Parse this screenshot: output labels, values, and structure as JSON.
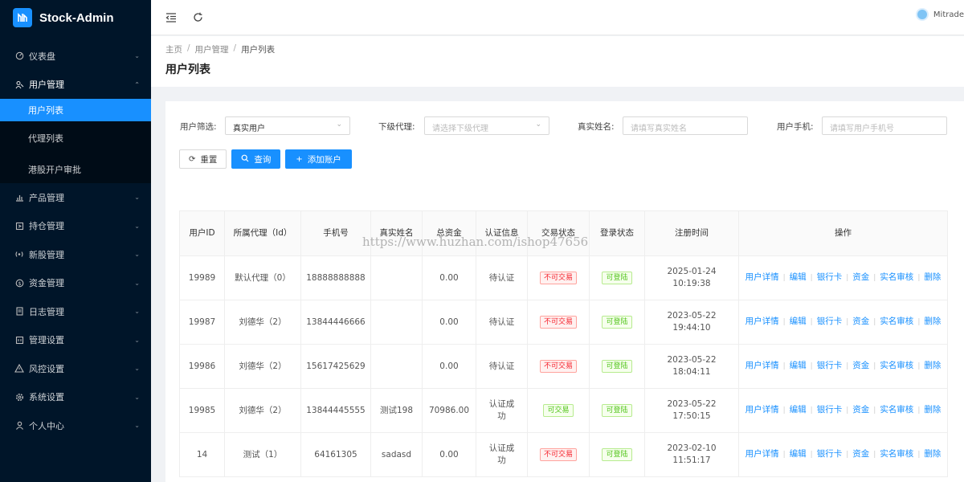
{
  "app": {
    "name": "Stock-Admin"
  },
  "sidebar": {
    "items": [
      {
        "label": "仪表盘",
        "icon": "dashboard-icon"
      },
      {
        "label": "用户管理",
        "icon": "user-manage-icon",
        "expanded": true,
        "children": [
          {
            "label": "用户列表",
            "active": true
          },
          {
            "label": "代理列表"
          },
          {
            "label": "港股开户审批"
          }
        ]
      },
      {
        "label": "产品管理",
        "icon": "chart-icon"
      },
      {
        "label": "持仓管理",
        "icon": "position-icon"
      },
      {
        "label": "新股管理",
        "icon": "signal-icon"
      },
      {
        "label": "资金管理",
        "icon": "money-icon"
      },
      {
        "label": "日志管理",
        "icon": "log-icon"
      },
      {
        "label": "管理设置",
        "icon": "admin-settings-icon"
      },
      {
        "label": "风控设置",
        "icon": "warning-icon"
      },
      {
        "label": "系统设置",
        "icon": "gear-icon"
      },
      {
        "label": "个人中心",
        "icon": "person-icon"
      }
    ]
  },
  "header": {
    "user_name": "Mitrade"
  },
  "breadcrumb": [
    "主页",
    "用户管理",
    "用户列表"
  ],
  "page_title": "用户列表",
  "filters": {
    "user_filter": {
      "label": "用户筛选:",
      "value": "真实用户"
    },
    "sub_agent": {
      "label": "下级代理:",
      "placeholder": "请选择下级代理"
    },
    "real_name": {
      "label": "真实姓名:",
      "placeholder": "请填写真实姓名"
    },
    "phone": {
      "label": "用户手机:",
      "placeholder": "请填写用户手机号"
    }
  },
  "buttons": {
    "reset": "重置",
    "query": "查询",
    "add": "添加账户"
  },
  "table": {
    "headers": [
      "用户ID",
      "所属代理（Id）",
      "手机号",
      "真实姓名",
      "总资金",
      "认证信息",
      "交易状态",
      "登录状态",
      "注册时间",
      "操作"
    ],
    "rows": [
      {
        "id": "19989",
        "agent": "默认代理（0）",
        "phone": "18888888888",
        "name": "",
        "funds": "0.00",
        "auth": "待认证",
        "trade": "不可交易",
        "trade_ok": false,
        "login": "可登陆",
        "date": "2025-01-24",
        "time": "10:19:38"
      },
      {
        "id": "19987",
        "agent": "刘德华（2）",
        "phone": "13844446666",
        "name": "",
        "funds": "0.00",
        "auth": "待认证",
        "trade": "不可交易",
        "trade_ok": false,
        "login": "可登陆",
        "date": "2023-05-22",
        "time": "19:44:10"
      },
      {
        "id": "19986",
        "agent": "刘德华（2）",
        "phone": "15617425629",
        "name": "",
        "funds": "0.00",
        "auth": "待认证",
        "trade": "不可交易",
        "trade_ok": false,
        "login": "可登陆",
        "date": "2023-05-22",
        "time": "18:04:11"
      },
      {
        "id": "19985",
        "agent": "刘德华（2）",
        "phone": "13844445555",
        "name": "测试198",
        "funds": "70986.00",
        "auth": "认证成功",
        "trade": "可交易",
        "trade_ok": true,
        "login": "可登陆",
        "date": "2023-05-22",
        "time": "17:50:15"
      },
      {
        "id": "14",
        "agent": "测试（1）",
        "phone": "64161305",
        "name": "sadasd",
        "funds": "0.00",
        "auth": "认证成功",
        "trade": "不可交易",
        "trade_ok": false,
        "login": "可登陆",
        "date": "2023-02-10",
        "time": "11:51:17"
      }
    ],
    "actions": [
      "用户详情",
      "编辑",
      "银行卡",
      "资金",
      "实名审核",
      "删除"
    ]
  },
  "watermark": "https://www.huzhan.com/ishop47656",
  "colors": {
    "sidebar_bg": "#001529",
    "primary": "#1890ff",
    "danger": "#f5222d",
    "success": "#52c41a"
  }
}
